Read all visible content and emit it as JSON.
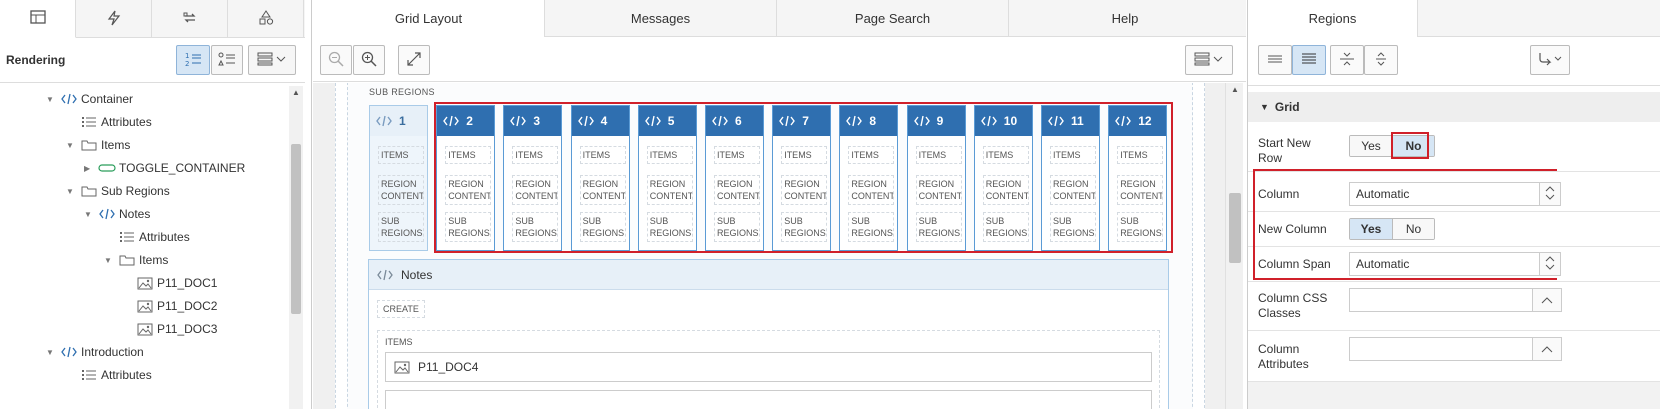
{
  "left_panel": {
    "tabs": [
      {
        "icon": "table-icon"
      },
      {
        "icon": "lightning-icon"
      },
      {
        "icon": "shared-components-icon"
      },
      {
        "icon": "shapes-icon"
      }
    ],
    "rendering_label": "Rendering",
    "tree": [
      {
        "label": "Container",
        "icon": "code-icon",
        "expanded": true
      },
      {
        "label": "Attributes",
        "icon": "list-icon"
      },
      {
        "label": "Items",
        "icon": "folder-icon",
        "expanded": true
      },
      {
        "label": "TOGGLE_CONTAINER",
        "icon": "toggle-icon",
        "expanded": false
      },
      {
        "label": "Sub Regions",
        "icon": "folder-icon",
        "expanded": true
      },
      {
        "label": "Notes",
        "icon": "code-icon",
        "expanded": true
      },
      {
        "label": "Attributes",
        "icon": "list-icon"
      },
      {
        "label": "Items",
        "icon": "folder-icon",
        "expanded": true
      },
      {
        "label": "P11_DOC1",
        "icon": "image-icon"
      },
      {
        "label": "P11_DOC2",
        "icon": "image-icon"
      },
      {
        "label": "P11_DOC3",
        "icon": "image-icon"
      },
      {
        "label": "Introduction",
        "icon": "code-icon",
        "expanded": true
      },
      {
        "label": "Attributes",
        "icon": "list-icon"
      }
    ]
  },
  "center": {
    "tabs": [
      "Grid Layout",
      "Messages",
      "Page Search",
      "Help"
    ],
    "active_tab": "Grid Layout",
    "sub_regions_label": "SUB REGIONS",
    "columns": [
      "1",
      "2",
      "3",
      "4",
      "5",
      "6",
      "7",
      "8",
      "9",
      "10",
      "11",
      "12"
    ],
    "slot_items": "ITEMS",
    "slot_region_1": "REGION",
    "slot_region_2": "CONTENT",
    "slot_sub_1": "SUB",
    "slot_sub_2": "REGIONS",
    "notes": {
      "title": "Notes",
      "create_label": "CREATE",
      "items_label": "ITEMS",
      "item": "P11_DOC4"
    }
  },
  "right_panel": {
    "tab": "Regions",
    "section": "Grid",
    "properties": {
      "start_new_row": {
        "label_1": "Start New",
        "label_2": "Row",
        "options": [
          "Yes",
          "No"
        ],
        "selected": "No"
      },
      "column": {
        "label": "Column",
        "value": "Automatic"
      },
      "new_column": {
        "label": "New Column",
        "options": [
          "Yes",
          "No"
        ],
        "selected": "Yes"
      },
      "column_span": {
        "label": "Column Span",
        "value": "Automatic"
      },
      "column_css": {
        "label_1": "Column CSS",
        "label_2": "Classes",
        "value": ""
      },
      "column_attributes": {
        "label_1": "Column",
        "label_2": "Attributes",
        "value": ""
      }
    }
  },
  "colors": {
    "accent_blue": "#2f6fb0",
    "highlight_red": "#d0202a",
    "selected_bg": "#d6e6f5"
  }
}
